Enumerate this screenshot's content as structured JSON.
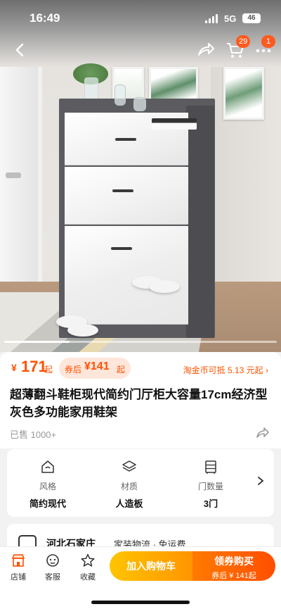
{
  "status_bar": {
    "time": "16:49",
    "network": "5G",
    "battery": "46"
  },
  "nav": {
    "cart_count": "29",
    "message_count": "1"
  },
  "gallery": {
    "progress_fraction": 0.24
  },
  "price": {
    "currency": "¥",
    "original": "171",
    "original_unit": "起",
    "coupon_label": "券后",
    "coupon_currency": "¥",
    "coupon_price": "141",
    "coupon_unit": "起",
    "coin_text": "淘金币可抵 5.13 元起 ›"
  },
  "product": {
    "title": "超薄翻斗鞋柜现代简约门厅柜大容量17cm经济型灰色多功能家用鞋架",
    "sold": "已售 1000+"
  },
  "attributes": [
    {
      "label": "风格",
      "value": "简约现代",
      "icon": "style-house-icon"
    },
    {
      "label": "材质",
      "value": "人造板",
      "icon": "layers-icon"
    },
    {
      "label": "门数量",
      "value": "3门",
      "icon": "cabinet-icon"
    }
  ],
  "shop": {
    "name": "河北石家庄",
    "shipping": "家装物流 · 免运费"
  },
  "bottom_bar": {
    "tabs": [
      {
        "label": "店铺",
        "icon": "shop-icon"
      },
      {
        "label": "客服",
        "icon": "service-icon"
      },
      {
        "label": "收藏",
        "icon": "star-icon"
      }
    ],
    "add_cart": "加入购物车",
    "buy_label": "领券购买",
    "buy_sub": "券后 ¥ 141起"
  },
  "colors": {
    "accent": "#ff5000",
    "cart_button": "#ffb300",
    "buy_button": "#ff5a00"
  }
}
